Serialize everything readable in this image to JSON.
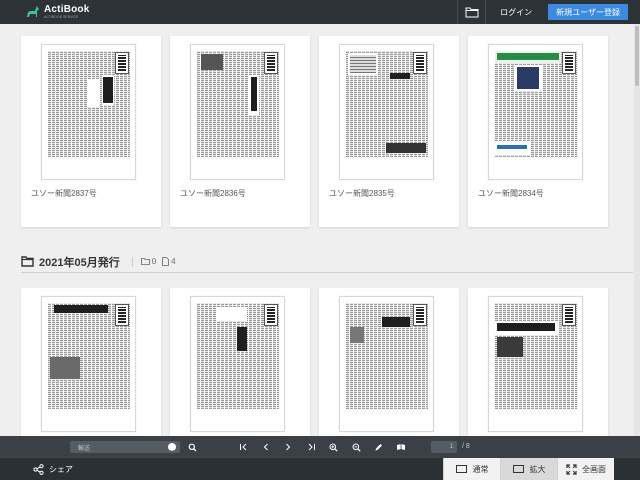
{
  "header": {
    "logo_title": "ActiBook",
    "logo_sub": "ACTIBOOK SERVICE",
    "login_label": "ログイン",
    "register_label": "新規ユーザー登録"
  },
  "row1": [
    {
      "title": "ユソー新聞2837号"
    },
    {
      "title": "ユソー新聞2836号"
    },
    {
      "title": "ユソー新聞2835号"
    },
    {
      "title": "ユソー新聞2834号"
    }
  ],
  "section": {
    "title": "2021年05月発行",
    "folder_count": "0",
    "file_count": "4"
  },
  "row2": [
    {
      "title": ""
    },
    {
      "title": ""
    },
    {
      "title": ""
    },
    {
      "title": ""
    }
  ],
  "toolbar": {
    "search_placeholder": "輸送",
    "page_current": "1",
    "page_total": "/ 8"
  },
  "footer": {
    "share_label": "シェア",
    "view_normal": "通常",
    "view_zoom": "拡大",
    "view_fullscreen": "全画面"
  },
  "colors": {
    "header_bg": "#2e3338",
    "accent": "#3d8be0",
    "toolbar_bg": "#3a4046",
    "footer_bg": "#2b3035"
  }
}
